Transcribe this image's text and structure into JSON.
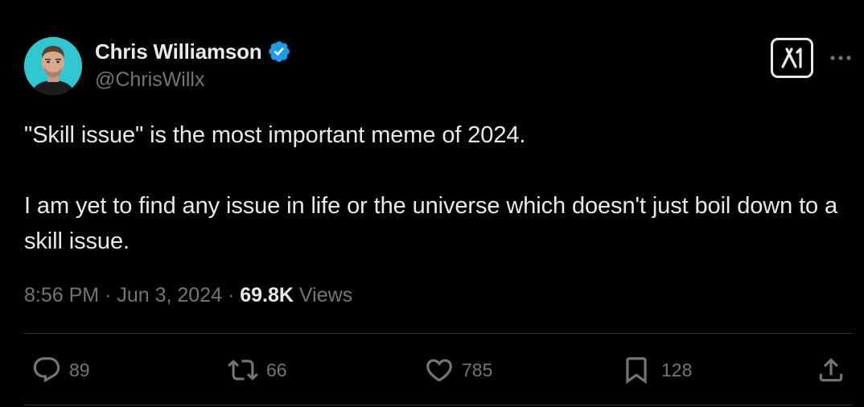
{
  "author": {
    "display_name": "Chris Williamson",
    "handle": "@ChrisWillx",
    "verified": true
  },
  "tweet": {
    "paragraphs": [
      "\"Skill issue\" is the most important meme of 2024.",
      "I am yet to find any issue in life or the universe which doesn't just boil down to a skill issue."
    ]
  },
  "meta": {
    "time": "8:56 PM",
    "separator": "·",
    "date": "Jun 3, 2024",
    "views_count": "69.8K",
    "views_label": "Views"
  },
  "actions": {
    "replies": "89",
    "reposts": "66",
    "likes": "785",
    "bookmarks": "128"
  },
  "icons": {
    "grok": "grok-icon",
    "more": "more-icon",
    "reply": "reply-icon",
    "repost": "repost-icon",
    "like": "heart-icon",
    "bookmark": "bookmark-icon",
    "share": "share-icon"
  },
  "colors": {
    "background": "#000000",
    "text_primary": "#e7e9ea",
    "text_secondary": "#71767b",
    "verified_blue": "#1d9bf0",
    "avatar_bg": "#2fc6cf"
  }
}
